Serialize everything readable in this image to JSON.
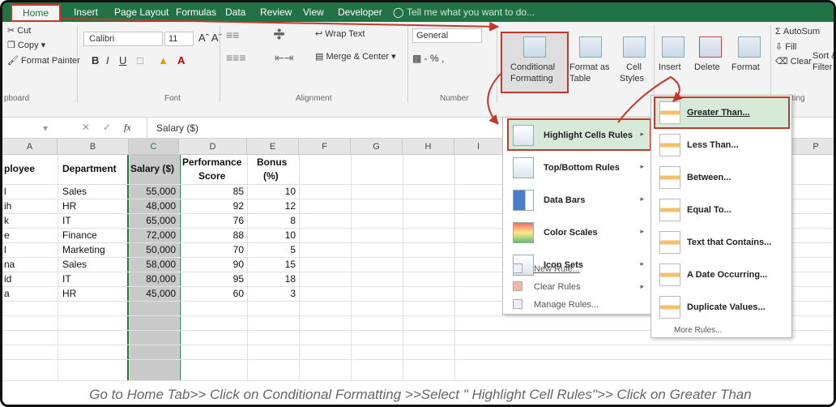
{
  "tabs": [
    "Home",
    "Insert",
    "Page Layout",
    "Formulas",
    "Data",
    "Review",
    "View",
    "Developer"
  ],
  "tell_me": "Tell me what you want to do...",
  "clipboard": {
    "cut": "Cut",
    "copy": "Copy",
    "painter": "Format Painter",
    "label": "pboard"
  },
  "font": {
    "name": "Calibri",
    "size": "11",
    "label": "Font"
  },
  "alignment": {
    "wrap": "Wrap Text",
    "merge": "Merge & Center",
    "label": "Alignment"
  },
  "number": {
    "format": "General",
    "label": "Number"
  },
  "styles": {
    "cf_line1": "Conditional",
    "cf_line2": "Formatting",
    "fat_line1": "Format as",
    "fat_line2": "Table",
    "cs_line1": "Cell",
    "cs_line2": "Styles"
  },
  "cells": {
    "insert": "Insert",
    "delete": "Delete",
    "format": "Format"
  },
  "editing": {
    "autosum": "AutoSum",
    "fill": "Fill",
    "clear": "Clear",
    "sort1": "Sort &",
    "sort2": "Filter",
    "label": "Editing"
  },
  "formula_bar": {
    "fx": "fx",
    "content": "Salary ($)"
  },
  "columns": [
    "A",
    "B",
    "C",
    "D",
    "E",
    "F",
    "G",
    "H",
    "I",
    "P"
  ],
  "headers": {
    "a": "ployee",
    "b": "Department",
    "c": "Salary ($)",
    "d1": "Performance",
    "d2": "Score",
    "e1": "Bonus",
    "e2": "(%)"
  },
  "rows": [
    {
      "a": "l",
      "b": "Sales",
      "c": "55,000",
      "d": "85",
      "e": "10"
    },
    {
      "a": "ih",
      "b": "HR",
      "c": "48,000",
      "d": "92",
      "e": "12"
    },
    {
      "a": "k",
      "b": "IT",
      "c": "65,000",
      "d": "76",
      "e": "8"
    },
    {
      "a": "e",
      "b": "Finance",
      "c": "72,000",
      "d": "88",
      "e": "10"
    },
    {
      "a": "l",
      "b": "Marketing",
      "c": "50,000",
      "d": "70",
      "e": "5"
    },
    {
      "a": "na",
      "b": "Sales",
      "c": "58,000",
      "d": "90",
      "e": "15"
    },
    {
      "a": "id",
      "b": "IT",
      "c": "80,000",
      "d": "95",
      "e": "18"
    },
    {
      "a": "a",
      "b": "HR",
      "c": "45,000",
      "d": "60",
      "e": "3"
    }
  ],
  "cf_menu": {
    "items": [
      "Highlight Cells Rules",
      "Top/Bottom Rules",
      "Data Bars",
      "Color Scales",
      "Icon Sets"
    ],
    "small": [
      "New Rule...",
      "Clear Rules",
      "Manage Rules..."
    ]
  },
  "submenu": {
    "items": [
      "Greater Than...",
      "Less Than...",
      "Between...",
      "Equal To...",
      "Text that Contains...",
      "A Date Occurring...",
      "Duplicate Values..."
    ],
    "more": "More Rules..."
  },
  "caption": "Go to Home Tab>> Click on Conditional Formatting >>Select \" Highlight Cell Rules\">> Click on Greater Than",
  "colors": {
    "excel_green": "#217346",
    "highlight_red": "#c0392b",
    "selected_col": "#c9c9c9"
  }
}
